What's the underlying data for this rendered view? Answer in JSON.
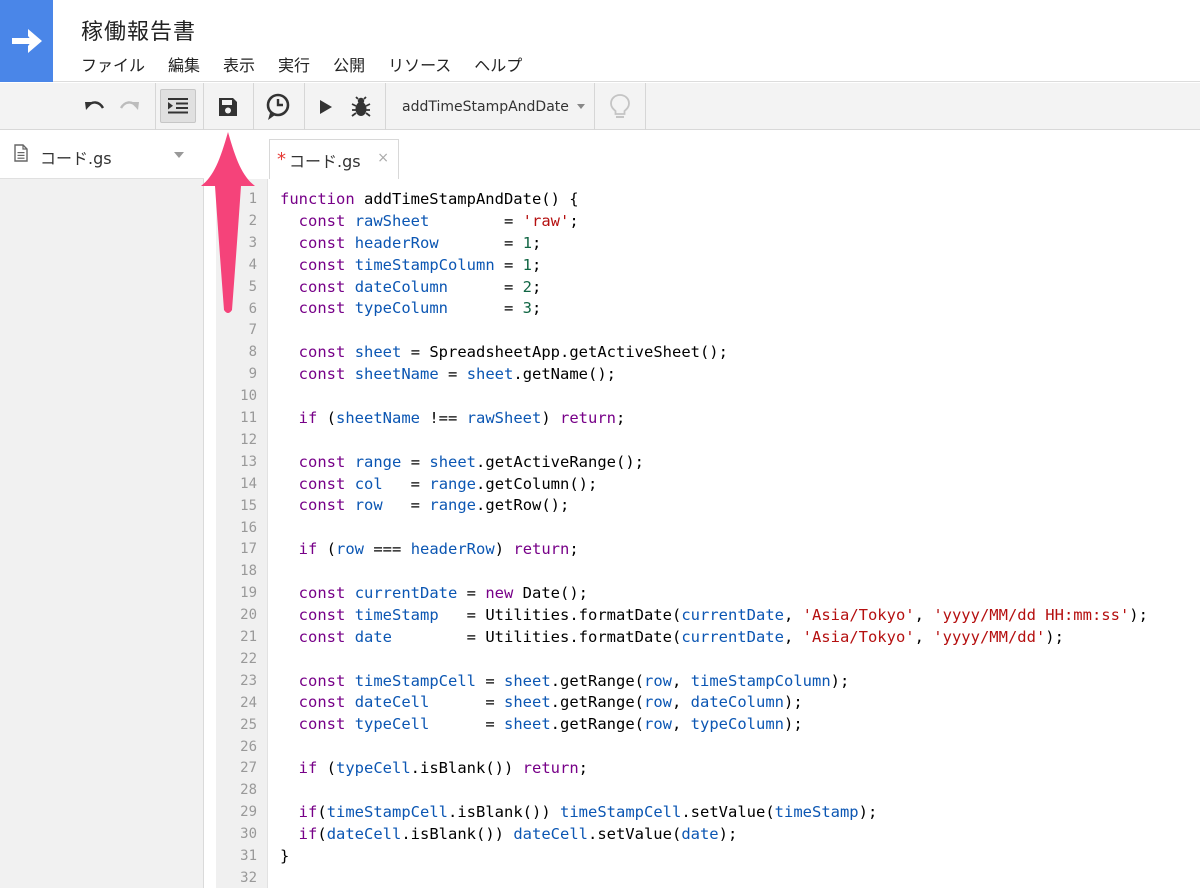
{
  "project_title": "稼働報告書",
  "menu": [
    "ファイル",
    "編集",
    "表示",
    "実行",
    "公開",
    "リソース",
    "ヘルプ"
  ],
  "toolbar": {
    "function_select": "addTimeStampAndDate"
  },
  "sidebar": {
    "file_name": "コード.gs"
  },
  "editor": {
    "tab_modified_mark": "*",
    "tab_label": "コード.gs",
    "tab_close": "×",
    "line_numbers": [
      "1",
      "2",
      "3",
      "4",
      "5",
      "6",
      "7",
      "8",
      "9",
      "10",
      "11",
      "12",
      "13",
      "14",
      "15",
      "16",
      "17",
      "18",
      "19",
      "20",
      "21",
      "22",
      "23",
      "24",
      "25",
      "26",
      "27",
      "28",
      "29",
      "30",
      "31",
      "32"
    ],
    "code_lines": [
      "function addTimeStampAndDate() {",
      "  const rawSheet        = 'raw';",
      "  const headerRow       = 1;",
      "  const timeStampColumn = 1;",
      "  const dateColumn      = 2;",
      "  const typeColumn      = 3;",
      "",
      "  const sheet = SpreadsheetApp.getActiveSheet();",
      "  const sheetName = sheet.getName();",
      "",
      "  if (sheetName !== rawSheet) return;",
      "",
      "  const range = sheet.getActiveRange();",
      "  const col   = range.getColumn();",
      "  const row   = range.getRow();",
      "",
      "  if (row === headerRow) return;",
      "",
      "  const currentDate = new Date();",
      "  const timeStamp   = Utilities.formatDate(currentDate, 'Asia/Tokyo', 'yyyy/MM/dd HH:mm:ss');",
      "  const date        = Utilities.formatDate(currentDate, 'Asia/Tokyo', 'yyyy/MM/dd');",
      "",
      "  const timeStampCell = sheet.getRange(row, timeStampColumn);",
      "  const dateCell      = sheet.getRange(row, dateColumn);",
      "  const typeCell      = sheet.getRange(row, typeColumn);",
      "",
      "  if (typeCell.isBlank()) return;",
      "",
      "  if(timeStampCell.isBlank()) timeStampCell.setValue(timeStamp);",
      "  if(dateCell.isBlank()) dateCell.setValue(date);",
      "}",
      ""
    ]
  },
  "colors": {
    "brand": "#4a86e8",
    "arrow": "#f5437a",
    "keyword": "#770088",
    "variable": "#0b56b3",
    "string": "#b51010",
    "number": "#116644"
  }
}
